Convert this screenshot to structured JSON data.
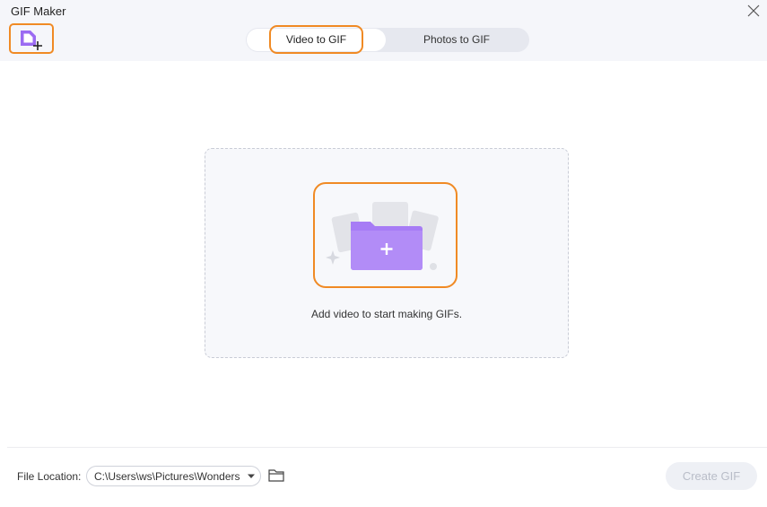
{
  "app": {
    "title": "GIF Maker"
  },
  "icons": {
    "close": "close-icon",
    "add_file": "add-file-icon",
    "folder_plus": "folder-plus-icon",
    "chevron": "chevron-down-icon",
    "folder": "folder-icon"
  },
  "tabs": [
    {
      "label": "Video to GIF",
      "active": true
    },
    {
      "label": "Photos to GIF",
      "active": false
    }
  ],
  "drop_zone": {
    "label": "Add video to start making GIFs."
  },
  "footer": {
    "file_location_label": "File Location:",
    "path_value": "C:\\Users\\ws\\Pictures\\Wonders",
    "create_label": "Create GIF",
    "create_enabled": false
  },
  "colors": {
    "accent": "#9b6bf2",
    "highlight": "#f08a24",
    "disabled_text": "#b9bdc8"
  }
}
